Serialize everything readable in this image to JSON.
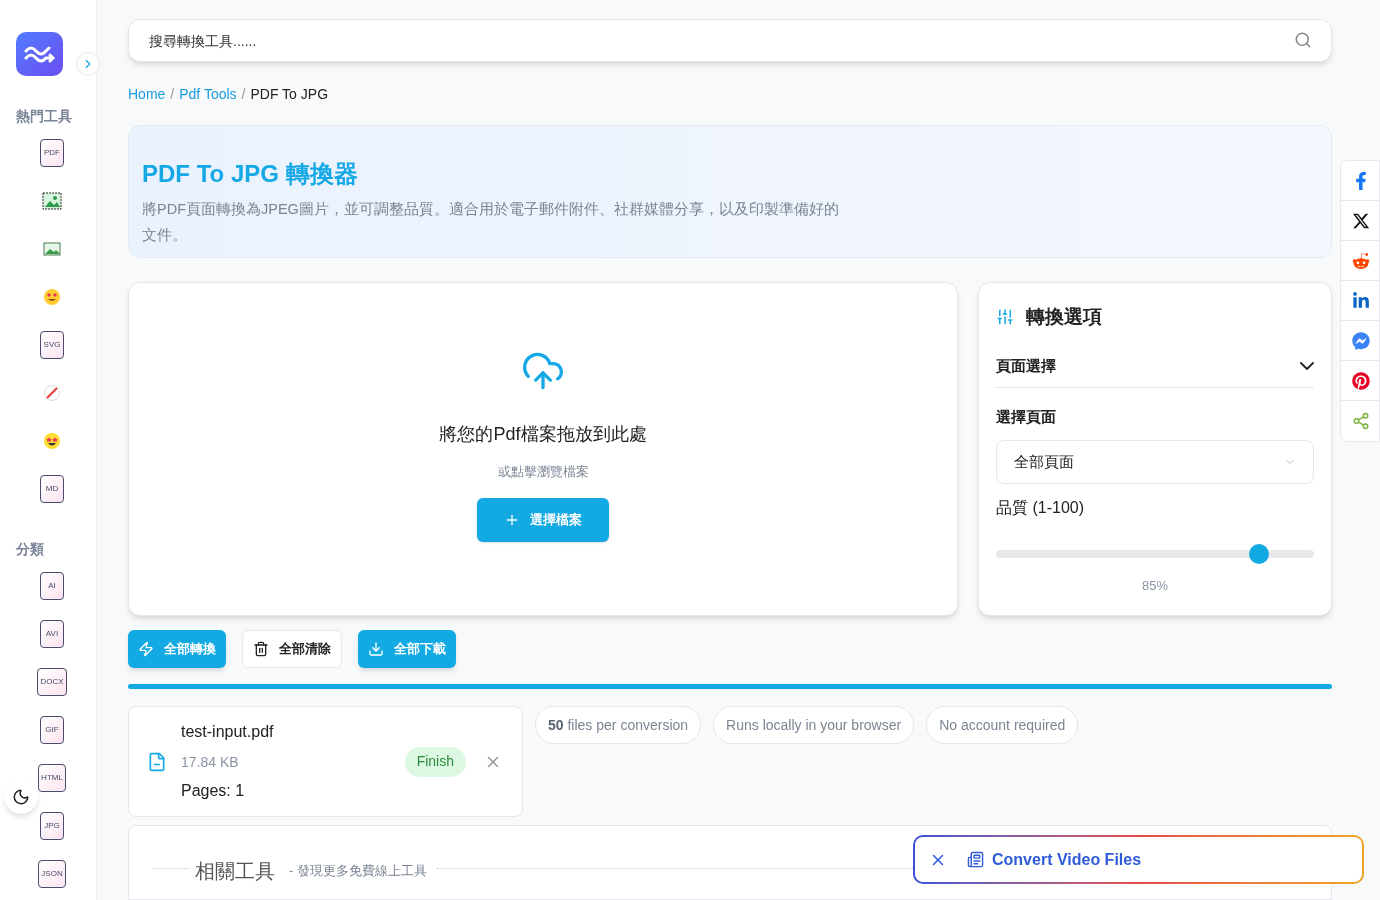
{
  "sidebar": {
    "hot_title": "熱門工具",
    "hot_tools": [
      {
        "kind": "file",
        "label": "PDF"
      },
      {
        "kind": "image-dashed"
      },
      {
        "kind": "image"
      },
      {
        "kind": "emoji-heart"
      },
      {
        "kind": "file",
        "label": "SVG"
      },
      {
        "kind": "slash"
      },
      {
        "kind": "emoji-star"
      },
      {
        "kind": "file",
        "label": "MD"
      }
    ],
    "category_title": "分類",
    "categories": [
      {
        "kind": "file",
        "label": "AI"
      },
      {
        "kind": "file",
        "label": "AVI"
      },
      {
        "kind": "file",
        "label": "DOCX"
      },
      {
        "kind": "file",
        "label": "GIF"
      },
      {
        "kind": "file",
        "label": "HTML"
      },
      {
        "kind": "file",
        "label": "JPG"
      },
      {
        "kind": "file",
        "label": "JSON"
      }
    ]
  },
  "search": {
    "placeholder": "搜尋轉換工具......"
  },
  "breadcrumb": {
    "links": [
      "Home",
      "Pdf Tools"
    ],
    "current": "PDF To JPG",
    "separators": [
      "/",
      "/"
    ]
  },
  "hero": {
    "title": "PDF To JPG 轉換器",
    "description": "將PDF頁面轉換為JPEG圖片，並可調整品質。適合用於電子郵件附件、社群媒體分享，以及印製準備好的文件。"
  },
  "upload": {
    "title": "將您的Pdf檔案拖放到此處",
    "subtitle": "或點擊瀏覽檔案",
    "button": "選擇檔案"
  },
  "options": {
    "title": "轉換選項",
    "section": "頁面選擇",
    "expanded": true,
    "select_label": "選擇頁面",
    "select_value": "全部頁面",
    "quality_label": "品質 (1-100)",
    "quality": {
      "level": 0.85,
      "reading": "85%"
    }
  },
  "actions": [
    {
      "kind": "convert",
      "label": "全部轉換"
    },
    {
      "kind": "clear",
      "label": "全部清除"
    },
    {
      "kind": "download",
      "label": "全部下載"
    }
  ],
  "progress": {
    "level": 1
  },
  "file": {
    "name": "test-input.pdf",
    "size": "17.84 KB",
    "pages": "Pages: 1",
    "status": "Finish"
  },
  "chips": [
    "**50** files per conversion",
    "Runs locally in your browser",
    "No account required"
  ],
  "related": {
    "title": "相關工具",
    "subtitle": "- 發現更多免費線上工具"
  },
  "toast": {
    "label": "Convert Video Files"
  }
}
